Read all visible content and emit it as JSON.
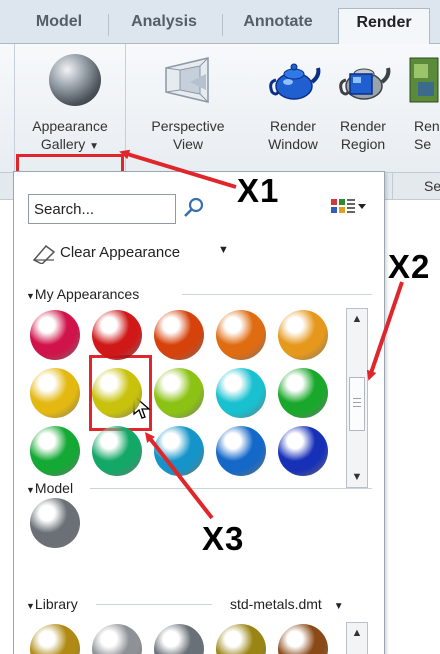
{
  "tabs": [
    {
      "label": "Model",
      "active": false
    },
    {
      "label": "Analysis",
      "active": false
    },
    {
      "label": "Annotate",
      "active": false
    },
    {
      "label": "Render",
      "active": true
    }
  ],
  "ribbon": {
    "appearance_gallery": {
      "line1": "Appearance",
      "line2": "Gallery",
      "dropdown": "▼"
    },
    "perspective_view": {
      "line1": "Perspective",
      "line2": "View"
    },
    "render_window": {
      "line1": "Render",
      "line2": "Window"
    },
    "render_region": {
      "line1": "Render",
      "line2": "Region"
    },
    "render_setup_partial": {
      "line1": "Ren",
      "line2": "Se"
    },
    "strip_label_partial": "Se"
  },
  "gallery": {
    "search_placeholder": "Search...",
    "clear_appearance": "Clear Appearance",
    "sections": {
      "my_appearances": "My Appearances",
      "model": "Model",
      "library": "Library",
      "library_file": "std-metals.dmt"
    },
    "my_appearances_colors": [
      [
        "#d0134a",
        "#d01818",
        "#d6420b",
        "#e06c12",
        "#e6981c"
      ],
      [
        "#e3b810",
        "#c8c20c",
        "#8cc214",
        "#18c0d0",
        "#1aa82c"
      ],
      [
        "#14a834",
        "#14a868",
        "#1494c8",
        "#1468c8",
        "#1630b8"
      ]
    ],
    "model_colors": [
      "#6a7076"
    ],
    "library_colors": [
      "#b08a14",
      "#8e9296",
      "#6a7078",
      "#9a8414",
      "#8a4a18"
    ]
  },
  "annotations": {
    "x1": "X1",
    "x2": "X2",
    "x3": "X3",
    "color": "#e0262b"
  }
}
